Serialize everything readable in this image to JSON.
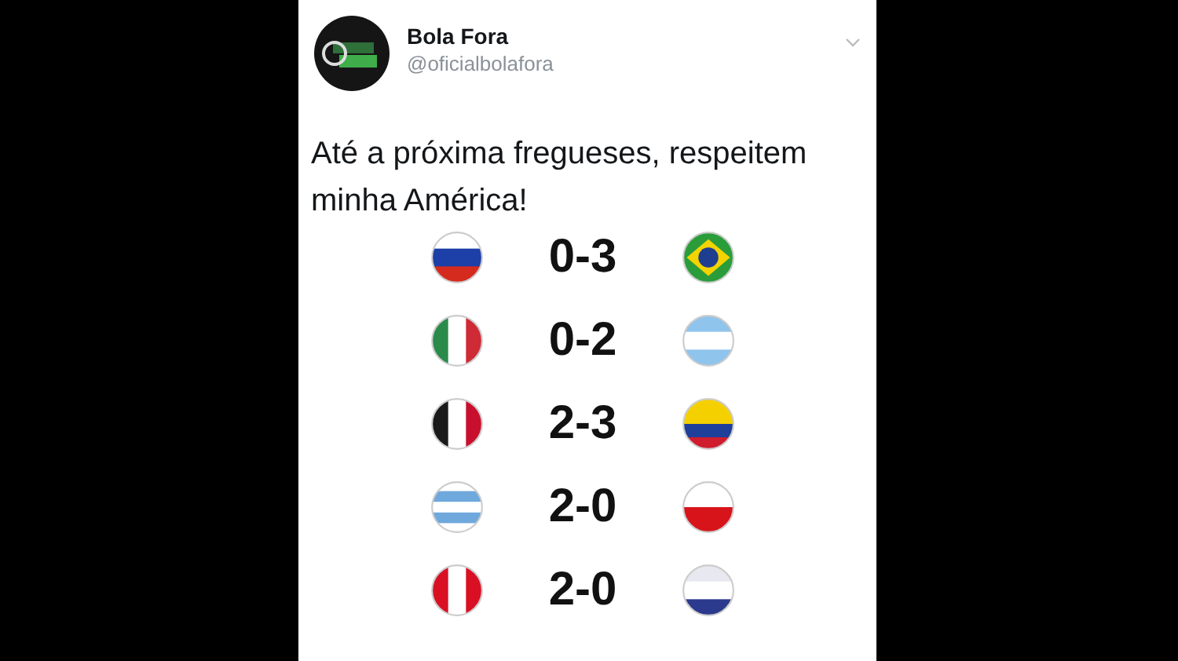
{
  "tweet": {
    "author": {
      "name": "Bola Fora",
      "handle": "@oficialbolafora"
    },
    "text": "Até a próxima fregueses, respeitem minha América!",
    "results": [
      {
        "score": "0-3"
      },
      {
        "score": "0-2"
      },
      {
        "score": "2-3"
      },
      {
        "score": "2-0"
      },
      {
        "score": "2-0"
      }
    ]
  }
}
